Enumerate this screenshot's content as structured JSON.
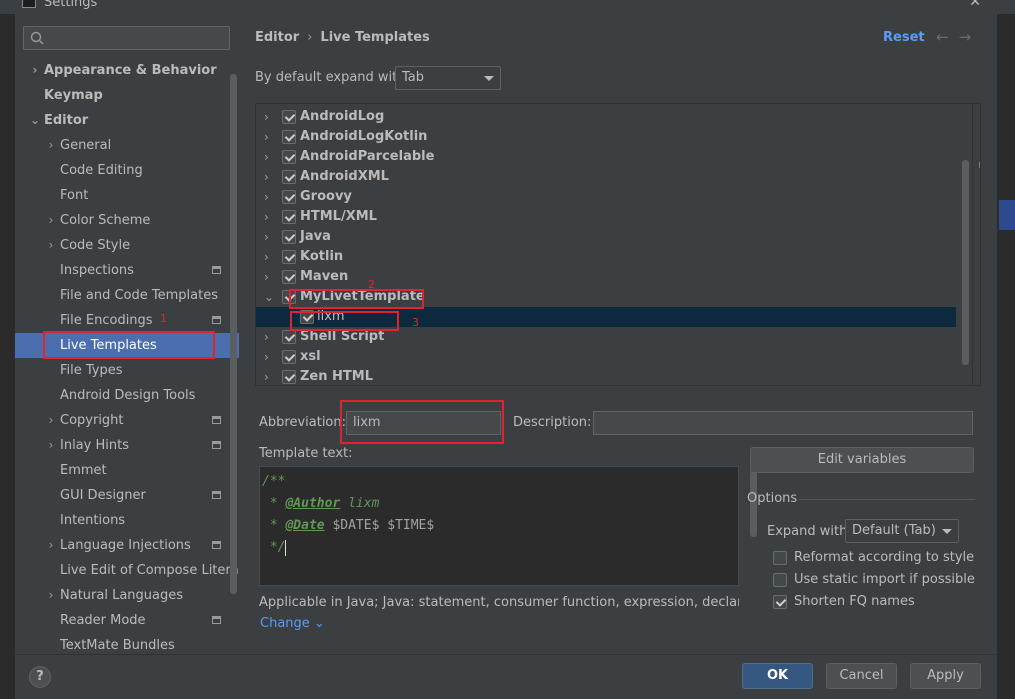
{
  "window": {
    "title": "Settings"
  },
  "sidebar": {
    "items": [
      {
        "label": "Appearance & Behavior",
        "level": 0,
        "expandable": true,
        "expanded": false,
        "bold": true
      },
      {
        "label": "Keymap",
        "level": 0,
        "expandable": false,
        "bold": true
      },
      {
        "label": "Editor",
        "level": 0,
        "expandable": true,
        "expanded": true,
        "bold": true
      },
      {
        "label": "General",
        "level": 1,
        "expandable": true
      },
      {
        "label": "Code Editing",
        "level": 1
      },
      {
        "label": "Font",
        "level": 1
      },
      {
        "label": "Color Scheme",
        "level": 1,
        "expandable": true
      },
      {
        "label": "Code Style",
        "level": 1,
        "expandable": true
      },
      {
        "label": "Inspections",
        "level": 1,
        "badge": true
      },
      {
        "label": "File and Code Templates",
        "level": 1
      },
      {
        "label": "File Encodings",
        "level": 1,
        "badge": true
      },
      {
        "label": "Live Templates",
        "level": 1,
        "selected": true
      },
      {
        "label": "File Types",
        "level": 1
      },
      {
        "label": "Android Design Tools",
        "level": 1
      },
      {
        "label": "Copyright",
        "level": 1,
        "expandable": true,
        "badge": true
      },
      {
        "label": "Inlay Hints",
        "level": 1,
        "expandable": true,
        "badge": true
      },
      {
        "label": "Emmet",
        "level": 1
      },
      {
        "label": "GUI Designer",
        "level": 1,
        "badge": true
      },
      {
        "label": "Intentions",
        "level": 1
      },
      {
        "label": "Language Injections",
        "level": 1,
        "expandable": true,
        "badge": true
      },
      {
        "label": "Live Edit of Compose Litera",
        "level": 1
      },
      {
        "label": "Natural Languages",
        "level": 1,
        "expandable": true
      },
      {
        "label": "Reader Mode",
        "level": 1,
        "badge": true
      },
      {
        "label": "TextMate Bundles",
        "level": 1
      }
    ]
  },
  "header": {
    "breadcrumb_parent": "Editor",
    "breadcrumb_sep": "›",
    "breadcrumb_current": "Live Templates",
    "reset_label": "Reset",
    "back_arrow": "←",
    "forward_arrow": "→"
  },
  "expand": {
    "label": "By default expand with",
    "value": "Tab"
  },
  "templates": [
    {
      "label": "AndroidLog",
      "expanded": false
    },
    {
      "label": "AndroidLogKotlin",
      "expanded": false
    },
    {
      "label": "AndroidParcelable",
      "expanded": false
    },
    {
      "label": "AndroidXML",
      "expanded": false
    },
    {
      "label": "Groovy",
      "expanded": false
    },
    {
      "label": "HTML/XML",
      "expanded": false
    },
    {
      "label": "Java",
      "expanded": false
    },
    {
      "label": "Kotlin",
      "expanded": false
    },
    {
      "label": "Maven",
      "expanded": false
    },
    {
      "label": "MyLivetTemplate",
      "expanded": true
    },
    {
      "label": "lixm",
      "child": true,
      "selected": true
    },
    {
      "label": "Shell Script",
      "expanded": false
    },
    {
      "label": "xsl",
      "expanded": false
    },
    {
      "label": "Zen HTML",
      "expanded": false
    }
  ],
  "list_toolbar": {
    "add": "+",
    "remove": "−",
    "copy": "⧉",
    "restore": "↺"
  },
  "annotations": {
    "one": "1",
    "two": "2",
    "three": "3"
  },
  "form": {
    "abbreviation_label": "Abbreviation:",
    "abbreviation_value": "lixm",
    "description_label": "Description:",
    "description_value": "",
    "template_text_label": "Template text:",
    "edit_variables_label": "Edit variables"
  },
  "template_text": {
    "line1": "/**",
    "line2_prefix": " * ",
    "line2_tag": "@Author",
    "line2_value": " lixm",
    "line3_prefix": " * ",
    "line3_tag": "@Date",
    "line3_value": " $DATE$ $TIME$",
    "line4": " */"
  },
  "options": {
    "title": "Options",
    "expand_with_label": "Expand with",
    "expand_with_value": "Default (Tab)",
    "reformat_label": "Reformat according to style",
    "reformat_checked": false,
    "static_import_label": "Use static import if possible",
    "static_import_checked": false,
    "shorten_fq_label": "Shorten FQ names",
    "shorten_fq_checked": true
  },
  "context": {
    "applicable": "Applicable in Java; Java: statement, consumer function, expression, declaration, c...",
    "change_label": "Change",
    "change_arrow": "⌄"
  },
  "footer": {
    "help": "?",
    "ok": "OK",
    "cancel": "Cancel",
    "apply": "Apply"
  },
  "colors": {
    "accent": "#589df6",
    "selection": "#4b6eaf",
    "annotation": "#e0232e"
  }
}
